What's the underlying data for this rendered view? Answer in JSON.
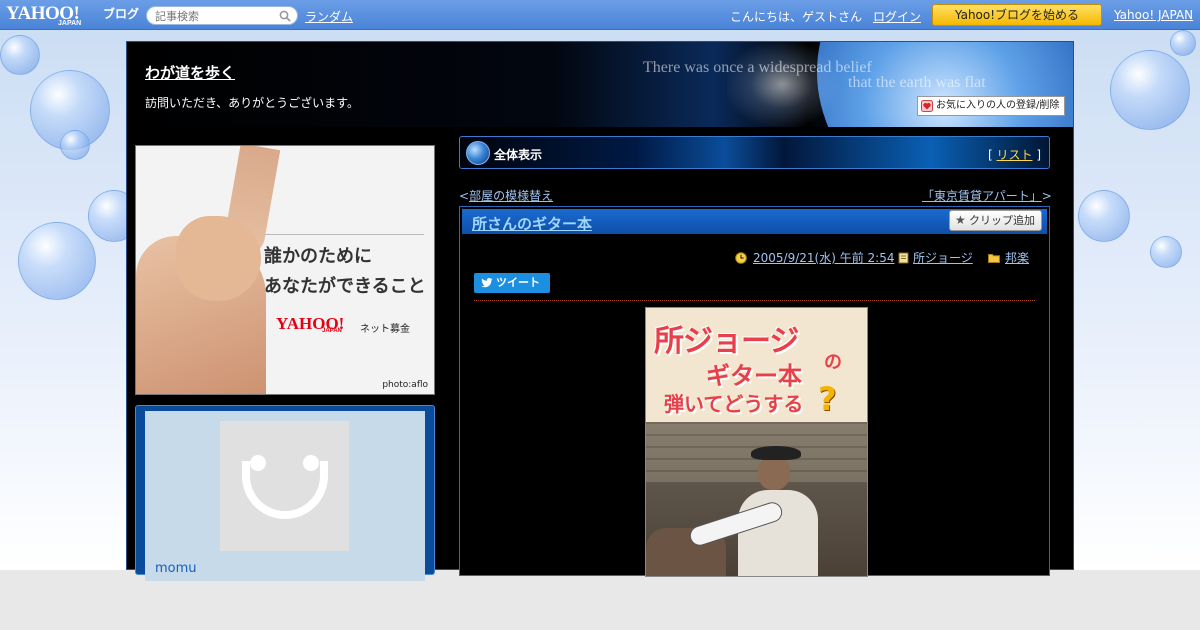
{
  "topbar": {
    "logo_text": "YAHOO!",
    "logo_sub": "JAPAN",
    "logo_blog": "ブログ",
    "search_placeholder": "記事検索",
    "random_link": "ランダム",
    "greeting": "こんにちは、ゲストさん",
    "login_link": "ログイン",
    "start_button": "Yahoo!ブログを始める",
    "yahoo_japan_link": "Yahoo! JAPAN"
  },
  "blog": {
    "title": "わが道を歩く",
    "description": "訪問いただき、ありがとうございます。",
    "header_motto_line1": "There was once a widespread belief",
    "header_motto_line2": "that the earth was flat",
    "favorite_button": "お気に入りの人の登録/削除"
  },
  "sidebar": {
    "ad": {
      "copy_line1": "誰かのために",
      "copy_line2": "あなたができること",
      "logo": "YAHOO!",
      "logo_sub": "JAPAN",
      "service": "ネット募金",
      "credit": "photo:aflo"
    },
    "profile": {
      "username": "momu"
    }
  },
  "main": {
    "section_label": "全体表示",
    "list_bracket_open": "[",
    "list_link": "リスト",
    "list_bracket_close": "]",
    "prev_mark": "<",
    "prev_link": "部屋の模様替え",
    "next_link": "「東京賃貸アパート」",
    "next_mark": ">",
    "article": {
      "title": "所さんのギター本",
      "clip_button": "クリップ追加",
      "datetime": "2005/9/21(水) 午前 2:54",
      "author": "所ジョージ",
      "category": "邦楽",
      "tweet_button": "ツイート",
      "image_caption_line1": "所ジョージ",
      "image_caption_no": "の",
      "image_caption_line2": "ギター本",
      "image_caption_line3": "弾いてどうする",
      "image_caption_mark": "?"
    }
  },
  "colors": {
    "topbar": "#4a83d8",
    "start_button": "#f5b800",
    "article_title_bar": "#1a6ad0",
    "link": "#9fc3ef",
    "list_link": "#ffd84a"
  }
}
